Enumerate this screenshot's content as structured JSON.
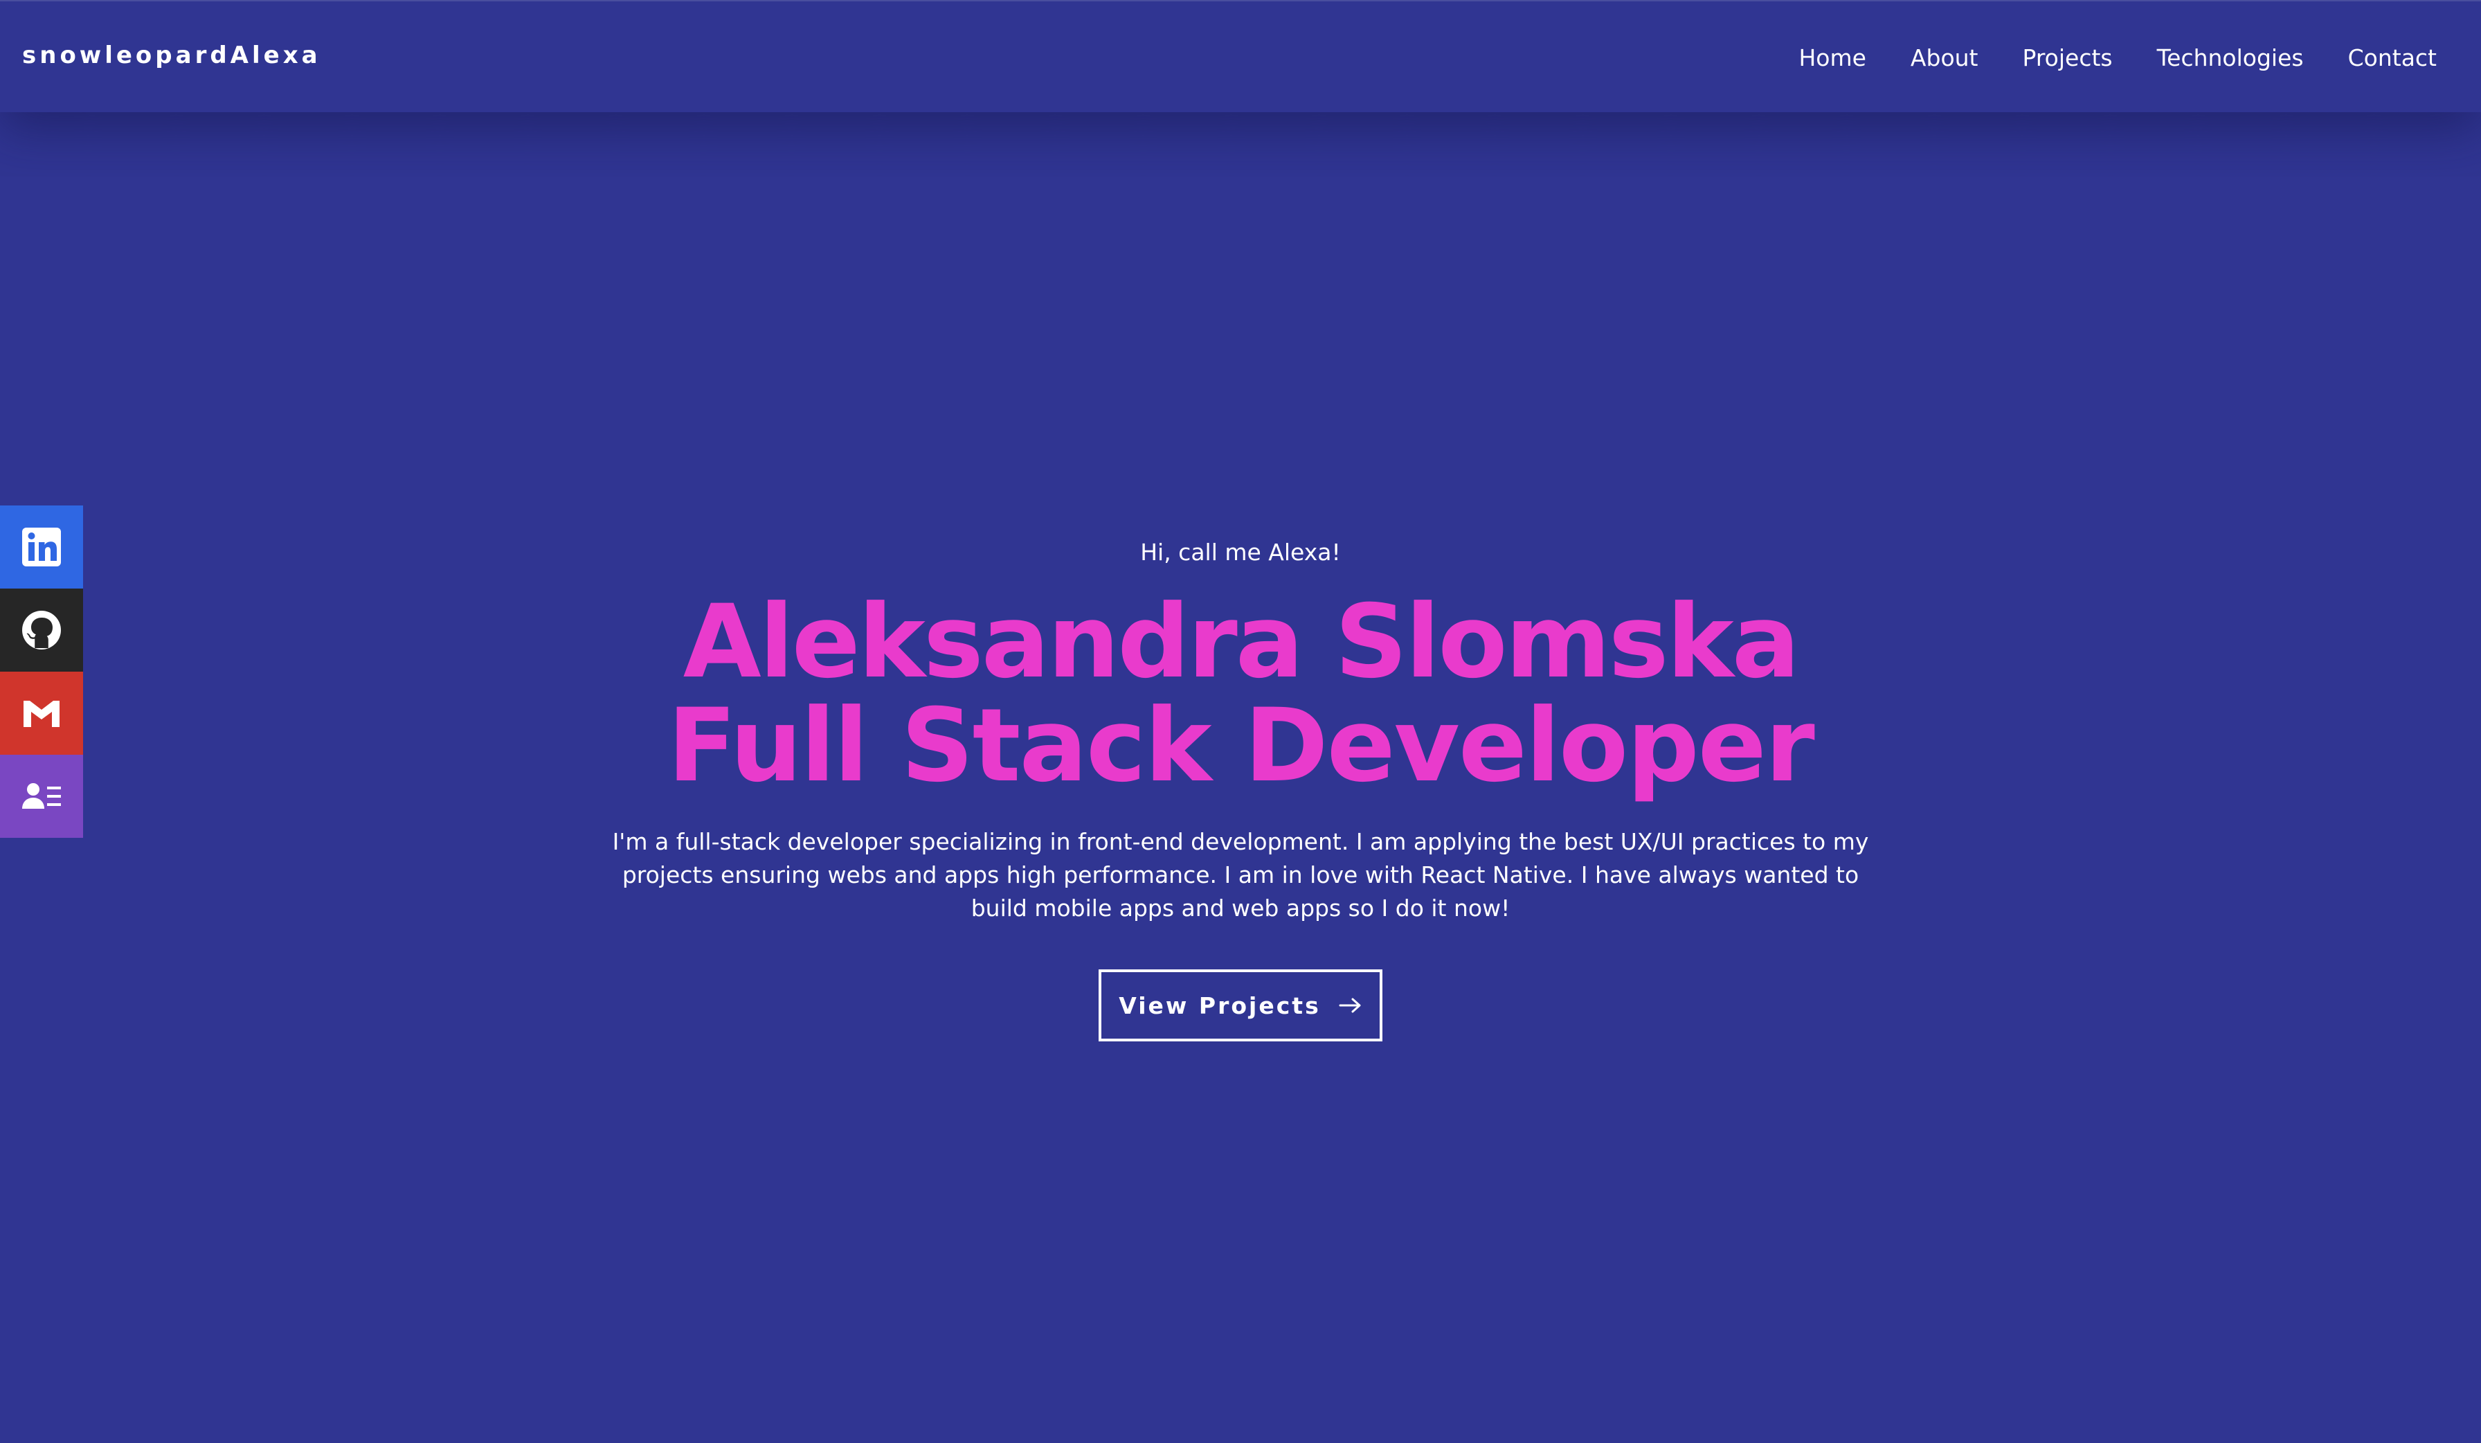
{
  "nav": {
    "brand": "snowleopardAlexa",
    "links": [
      "Home",
      "About",
      "Projects",
      "Technologies",
      "Contact"
    ]
  },
  "social": {
    "items": [
      {
        "name": "LinkedIn",
        "icon": "linkedin-icon",
        "color": "#2f67e3"
      },
      {
        "name": "GitHub",
        "icon": "github-icon",
        "color": "#262626"
      },
      {
        "name": "Gmail",
        "icon": "gmail-icon",
        "color": "#d0352c"
      },
      {
        "name": "Resume",
        "icon": "contact-card-icon",
        "color": "#7a47c2"
      }
    ]
  },
  "hero": {
    "greeting": "Hi, call me Alexa!",
    "name": "Aleksandra Slomska",
    "role": "Full Stack Developer",
    "intro": "I'm a full-stack developer specializing in front-end development. I am applying the best UX/UI practices to my projects ensuring webs and apps high performance. I am in love with React Native. I have always wanted to build mobile apps and web apps so I do it now!",
    "cta_label": "View Projects",
    "cta_icon": "arrow-right-icon"
  },
  "colors": {
    "background": "#303592",
    "accent": "#e93bcc",
    "text": "#ffffff"
  }
}
